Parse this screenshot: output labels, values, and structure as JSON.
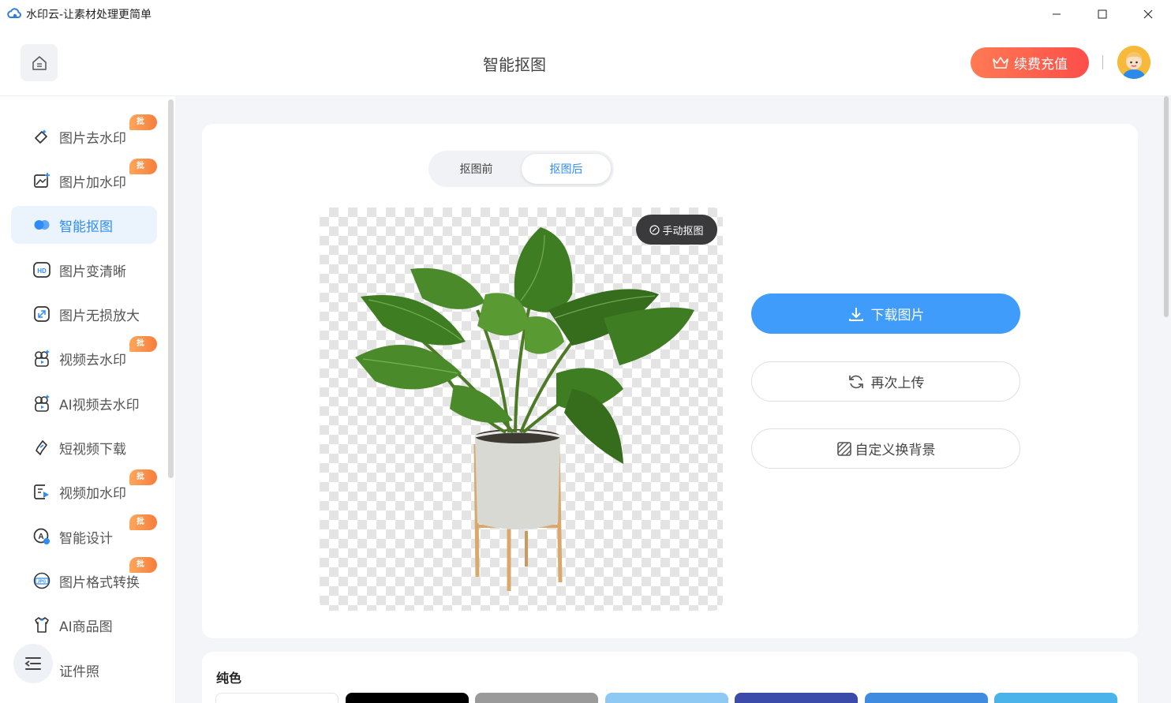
{
  "app": {
    "title": "水印云-让素材处理更简单"
  },
  "header": {
    "title": "智能抠图",
    "renew_label": "续费充值"
  },
  "sidebar": {
    "items": [
      {
        "label": "图片去水印",
        "badge": "批量",
        "icon": "eraser-icon"
      },
      {
        "label": "图片加水印",
        "badge": "批量",
        "icon": "image-add-icon"
      },
      {
        "label": "智能抠图",
        "badge": "",
        "icon": "cutout-icon",
        "active": true
      },
      {
        "label": "图片变清晰",
        "badge": "",
        "icon": "hd-icon"
      },
      {
        "label": "图片无损放大",
        "badge": "",
        "icon": "enlarge-icon"
      },
      {
        "label": "视频去水印",
        "badge": "批量",
        "icon": "video-eraser-icon"
      },
      {
        "label": "AI视频去水印",
        "badge": "",
        "icon": "ai-video-icon"
      },
      {
        "label": "短视频下载",
        "badge": "",
        "icon": "download-link-icon"
      },
      {
        "label": "视频加水印",
        "badge": "批量",
        "icon": "video-add-icon"
      },
      {
        "label": "智能设计",
        "badge": "批量",
        "icon": "design-icon"
      },
      {
        "label": "图片格式转换",
        "badge": "批量",
        "icon": "jpg-icon"
      },
      {
        "label": "AI商品图",
        "badge": "",
        "icon": "shirt-icon"
      },
      {
        "label": "证件照",
        "badge": "",
        "icon": "id-photo-icon"
      }
    ]
  },
  "editor": {
    "tabs": [
      {
        "label": "抠图前"
      },
      {
        "label": "抠图后",
        "active": true
      }
    ],
    "manual_label": "手动抠图",
    "download_label": "下载图片",
    "reupload_label": "再次上传",
    "custom_bg_label": "自定义换背景"
  },
  "background": {
    "title": "纯色",
    "swatches": [
      "#ffffff",
      "#000000",
      "#9a9a9a",
      "#8ec9f3",
      "#3b4ba9",
      "#3f8be0",
      "#4ab3ea"
    ]
  },
  "colors": {
    "accent": "#409cfb",
    "renew_start": "#ff7a53",
    "renew_end": "#fc4e4a",
    "badge": "#f68a45"
  }
}
